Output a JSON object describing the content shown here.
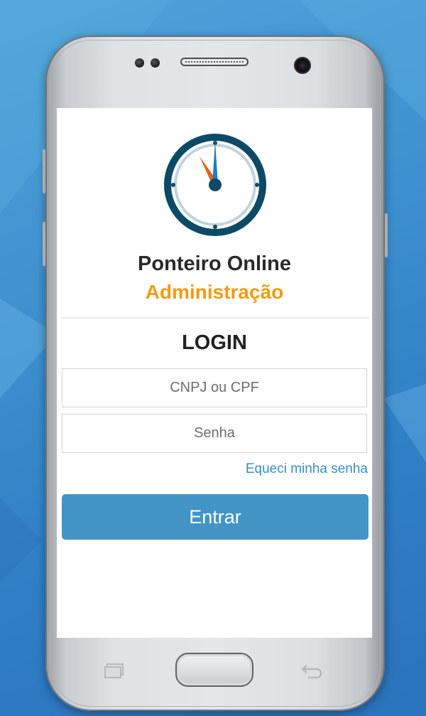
{
  "app": {
    "name": "Ponteiro Online",
    "subtitle": "Administração"
  },
  "login": {
    "title": "LOGIN",
    "document_placeholder": "CNPJ ou CPF",
    "password_placeholder": "Senha",
    "forgot_password": "Equeci minha senha",
    "submit_label": "Entrar"
  },
  "colors": {
    "accent": "#f39a12",
    "button": "#4295c6",
    "link": "#3a8cc4",
    "clock_ring": "#0d4a68",
    "clock_hand": "#1a7fc0",
    "clock_hand_secondary": "#e0621a"
  },
  "icons": {
    "logo": "clock-icon",
    "nav_recent": "recent-apps-icon",
    "nav_back": "back-icon"
  }
}
